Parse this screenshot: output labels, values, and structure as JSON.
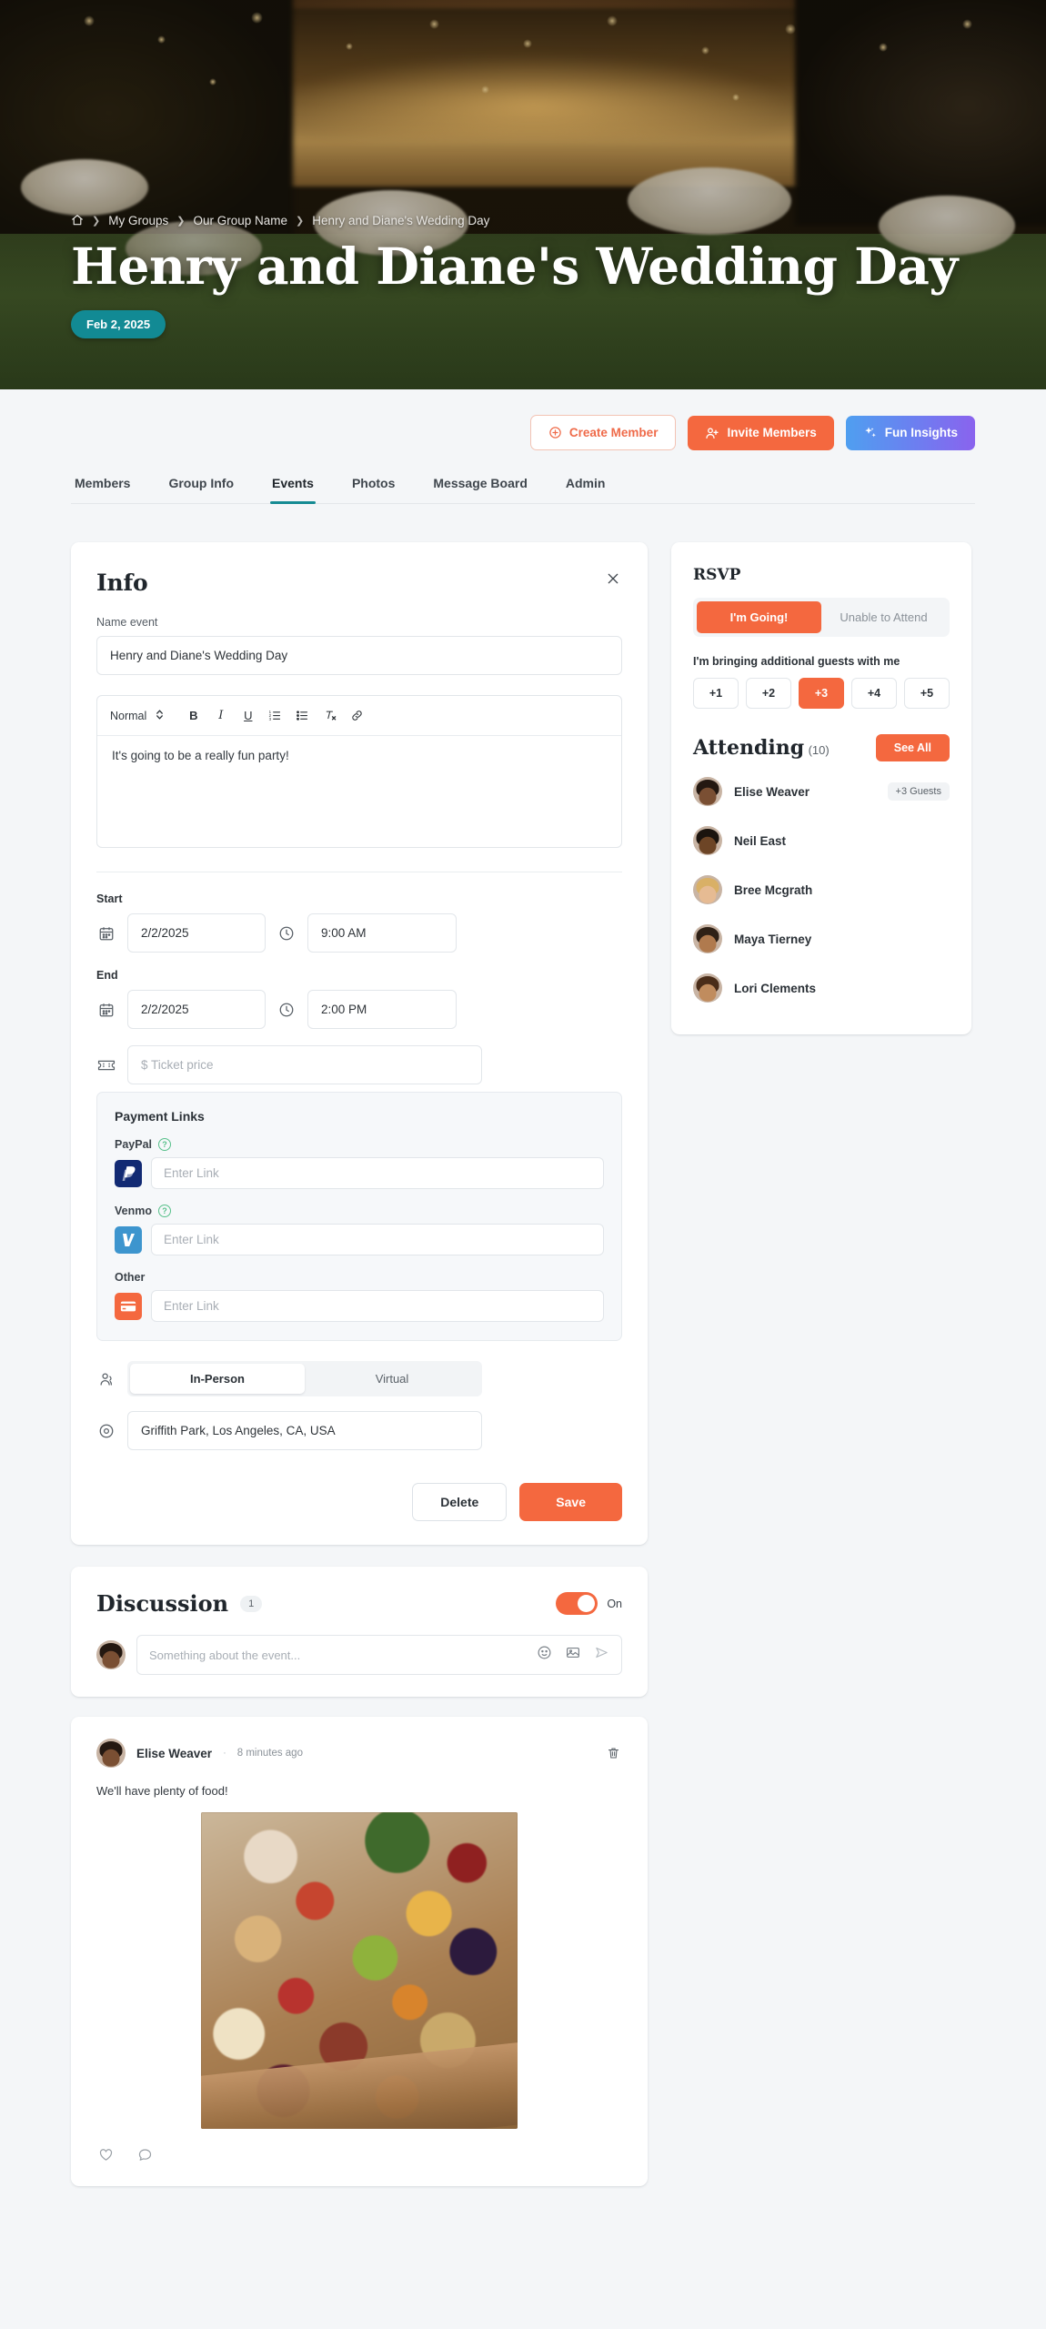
{
  "hero": {
    "breadcrumb": [
      {
        "label": "home-icon",
        "type": "icon"
      },
      {
        "label": "My Groups",
        "type": "link"
      },
      {
        "label": "Our Group Name",
        "type": "link"
      },
      {
        "label": "Henry and Diane's Wedding Day",
        "type": "current"
      }
    ],
    "breadcrumb_items": [
      "My Groups",
      "Our Group Name",
      "Henry and Diane's Wedding Day"
    ],
    "title": "Henry and Diane's Wedding Day",
    "date_badge": "Feb 2, 2025",
    "badge_color": "#128a94"
  },
  "actions": {
    "create_member": "Create Member",
    "invite_members": "Invite Members",
    "fun_insights": "Fun Insights",
    "accent_color": "#f4683f",
    "gradient_from": "#4f9ff0",
    "gradient_to": "#8a63ee"
  },
  "tabs": {
    "items": [
      "Members",
      "Group Info",
      "Events",
      "Photos",
      "Message Board",
      "Admin"
    ],
    "active": "Events",
    "active_color": "#158b93"
  },
  "info": {
    "title": "Info",
    "close_icon": "close-icon",
    "name_label": "Name event",
    "name_value": "Henry and Diane's Wedding Day",
    "editor": {
      "format_select": "Normal",
      "buttons": [
        "bold",
        "italic",
        "underline",
        "ordered-list",
        "bullet-list",
        "clear-format",
        "link"
      ],
      "body": "It's going to be a really fun party!"
    },
    "start_label": "Start",
    "start_date": "2/2/2025",
    "start_time": "9:00 AM",
    "end_label": "End",
    "end_date": "2/2/2025",
    "end_time": "2:00 PM",
    "ticket_placeholder": "$ Ticket price",
    "payment": {
      "title": "Payment Links",
      "paypal_label": "PayPal",
      "paypal_placeholder": "Enter Link",
      "venmo_label": "Venmo",
      "venmo_placeholder": "Enter Link",
      "other_label": "Other",
      "other_placeholder": "Enter Link"
    },
    "mode_options": [
      "In-Person",
      "Virtual"
    ],
    "mode_active": "In-Person",
    "location_value": "Griffith Park, Los Angeles, CA, USA",
    "delete_label": "Delete",
    "save_label": "Save"
  },
  "rsvp": {
    "title": "RSVP",
    "going_label": "I'm Going!",
    "not_going_label": "Unable to Attend",
    "selected": "I'm Going!",
    "guests_label": "I'm bringing additional guests with me",
    "guest_options": [
      "+1",
      "+2",
      "+3",
      "+4",
      "+5"
    ],
    "guest_selected": "+3"
  },
  "attending": {
    "title": "Attending",
    "count": "(10)",
    "see_all": "See All",
    "members": [
      {
        "name": "Elise Weaver",
        "tag": "+3 Guests",
        "skin": "#7a4f33",
        "hair": "#241811"
      },
      {
        "name": "Neil East",
        "tag": "",
        "skin": "#6d4526",
        "hair": "#1b140e"
      },
      {
        "name": "Bree Mcgrath",
        "tag": "",
        "skin": "#e6bb93",
        "hair": "#d4a martin"
      },
      {
        "name": "Maya Tierney",
        "tag": "",
        "skin": "#b07a4e",
        "hair": "#2f2116"
      },
      {
        "name": "Lori Clements",
        "tag": "",
        "skin": "#c08c5e",
        "hair": "#4a2d19"
      }
    ]
  },
  "discussion": {
    "title": "Discussion",
    "count": "1",
    "toggle_state": "On",
    "compose_placeholder": "Something about the event...",
    "compose_icons": [
      "emoji-icon",
      "image-icon",
      "send-icon"
    ],
    "post": {
      "author": "Elise Weaver",
      "separator": "·",
      "time": "8 minutes ago",
      "delete_icon": "trash-icon",
      "text": "We'll have plenty of food!",
      "image_alt": "charcuterie-grazing-table",
      "actions": [
        "like-icon",
        "comment-icon"
      ]
    }
  }
}
